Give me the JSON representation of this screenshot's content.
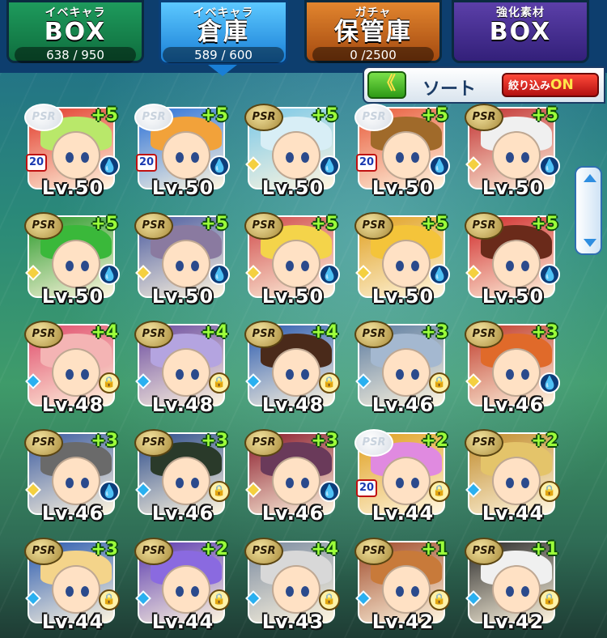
{
  "tabs": [
    {
      "top": "イベキャラ",
      "big": "BOX",
      "count": "638 / 950"
    },
    {
      "top": "イベキャラ",
      "big": "倉庫",
      "count": "589 / 600"
    },
    {
      "top": "ガチャ",
      "big": "保管庫",
      "count": "0  /2500"
    },
    {
      "top": "強化素材",
      "big": "BOX",
      "count": ""
    }
  ],
  "sort": {
    "button": "《",
    "label": "ソート",
    "filter_label": "絞り込み",
    "filter_state": "ON"
  },
  "cards": [
    {
      "plus": "+5",
      "level": "Lv.50",
      "badge": "PSR",
      "marker": "drop",
      "tag": "20",
      "hair": "#b9e86a",
      "bg": "#e23a2a"
    },
    {
      "plus": "+5",
      "level": "Lv.50",
      "badge": "PSR",
      "marker": "drop",
      "tag": "20",
      "hair": "#f2a23a",
      "bg": "#2a70d8"
    },
    {
      "plus": "+5",
      "level": "Lv.50",
      "badge": "PSR",
      "marker": "drop",
      "tag": "",
      "hair": "#d8eef6",
      "bg": "#7ac8e8"
    },
    {
      "plus": "+5",
      "level": "Lv.50",
      "badge": "PSR",
      "marker": "drop",
      "tag": "20",
      "hair": "#a06a2a",
      "bg": "#e85a3a"
    },
    {
      "plus": "+5",
      "level": "Lv.50",
      "badge": "PSR",
      "marker": "drop",
      "tag": "",
      "hair": "#f0f0f0",
      "bg": "#c23030"
    },
    {
      "plus": "+5",
      "level": "Lv.50",
      "badge": "PSR",
      "marker": "drop",
      "tag": "",
      "hair": "#3ab83a",
      "bg": "#2a9a2a"
    },
    {
      "plus": "+5",
      "level": "Lv.50",
      "badge": "PSR",
      "marker": "drop",
      "tag": "",
      "hair": "#8a7aa0",
      "bg": "#4a5aa0"
    },
    {
      "plus": "+5",
      "level": "Lv.50",
      "badge": "PSR",
      "marker": "drop",
      "tag": "",
      "hair": "#f4d44a",
      "bg": "#d04a4a"
    },
    {
      "plus": "+5",
      "level": "Lv.50",
      "badge": "PSR",
      "marker": "drop",
      "tag": "",
      "hair": "#f4c43a",
      "bg": "#e0a020"
    },
    {
      "plus": "+5",
      "level": "Lv.50",
      "badge": "PSR",
      "marker": "drop",
      "tag": "",
      "hair": "#6a2a1a",
      "bg": "#d02828"
    },
    {
      "plus": "+4",
      "level": "Lv.48",
      "badge": "PSR",
      "marker": "lock",
      "tag": "",
      "hair": "#f4b4b4",
      "bg": "#e04a6a"
    },
    {
      "plus": "+4",
      "level": "Lv.48",
      "badge": "PSR",
      "marker": "lock",
      "tag": "",
      "hair": "#b4a4e0",
      "bg": "#6a4aa0"
    },
    {
      "plus": "+4",
      "level": "Lv.48",
      "badge": "PSR",
      "marker": "lock",
      "tag": "",
      "hair": "#4a2a1a",
      "bg": "#2a5ab0"
    },
    {
      "plus": "+3",
      "level": "Lv.46",
      "badge": "PSR",
      "marker": "lock",
      "tag": "",
      "hair": "#a4b8d0",
      "bg": "#5a7aa0"
    },
    {
      "plus": "+3",
      "level": "Lv.46",
      "badge": "PSR",
      "marker": "drop",
      "tag": "",
      "hair": "#e06a2a",
      "bg": "#c03a2a"
    },
    {
      "plus": "+3",
      "level": "Lv.46",
      "badge": "PSR",
      "marker": "drop",
      "tag": "",
      "hair": "#6a6a6a",
      "bg": "#3a5aa0"
    },
    {
      "plus": "+3",
      "level": "Lv.46",
      "badge": "PSR",
      "marker": "lock",
      "tag": "",
      "hair": "#2a3a2a",
      "bg": "#2a4a8a"
    },
    {
      "plus": "+3",
      "level": "Lv.46",
      "badge": "PSR",
      "marker": "drop",
      "tag": "",
      "hair": "#6a3a5a",
      "bg": "#8a1a2a"
    },
    {
      "plus": "+2",
      "level": "Lv.44",
      "badge": "PSR",
      "marker": "lock",
      "tag": "20",
      "hair": "#e08ae0",
      "bg": "#e0a020"
    },
    {
      "plus": "+2",
      "level": "Lv.44",
      "badge": "PSR",
      "marker": "lock",
      "tag": "",
      "hair": "#e4c46a",
      "bg": "#c08a2a"
    },
    {
      "plus": "+3",
      "level": "Lv.44",
      "badge": "PSR",
      "marker": "lock",
      "tag": "",
      "hair": "#f4d48a",
      "bg": "#2a5ab0"
    },
    {
      "plus": "+2",
      "level": "Lv.44",
      "badge": "PSR",
      "marker": "lock",
      "tag": "",
      "hair": "#8a6ae0",
      "bg": "#5a3ab0"
    },
    {
      "plus": "+4",
      "level": "Lv.43",
      "badge": "PSR",
      "marker": "lock",
      "tag": "",
      "hair": "#d8d8d8",
      "bg": "#7a8aa0"
    },
    {
      "plus": "+1",
      "level": "Lv.42",
      "badge": "PSR",
      "marker": "lock",
      "tag": "",
      "hair": "#c87a3a",
      "bg": "#a04a2a"
    },
    {
      "plus": "+1",
      "level": "Lv.42",
      "badge": "PSR",
      "marker": "lock",
      "tag": "",
      "hair": "#f0f0f0",
      "bg": "#2a2a2a"
    }
  ],
  "colors": {
    "plus": "#9cff3a",
    "tab_active": "#1a7fd6",
    "filter_on": "#ffe64a"
  }
}
